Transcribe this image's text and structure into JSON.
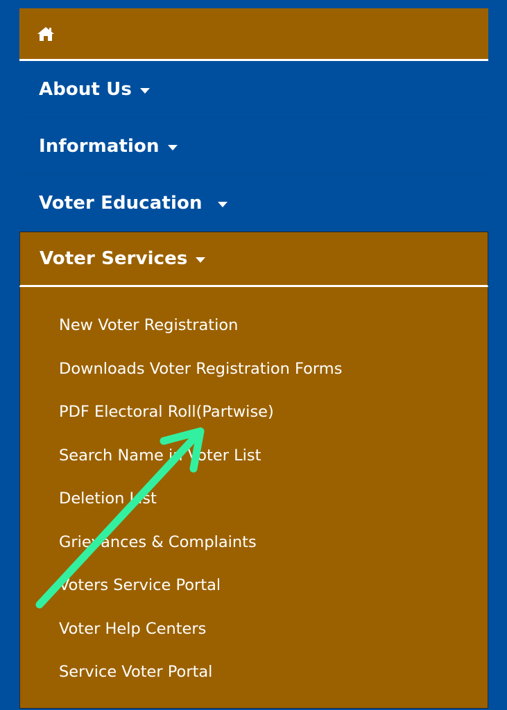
{
  "nav": {
    "home_icon": "home-icon",
    "items": [
      {
        "label": "About Us"
      },
      {
        "label": "Information"
      },
      {
        "label": "Voter Education"
      },
      {
        "label": "Voter Services"
      }
    ]
  },
  "submenu": {
    "items": [
      {
        "label": "New Voter Registration"
      },
      {
        "label": "Downloads Voter Registration Forms"
      },
      {
        "label": "PDF Electoral Roll(Partwise)"
      },
      {
        "label": "Search Name in Voter List"
      },
      {
        "label": "Deletion List"
      },
      {
        "label": "Grievances & Complaints"
      },
      {
        "label": "Voters Service Portal"
      },
      {
        "label": "Voter Help Centers"
      },
      {
        "label": "Service Voter Portal"
      }
    ]
  },
  "colors": {
    "background": "#004f9e",
    "menu_brown": "#9b6100",
    "annotation_arrow": "#33f0a0"
  }
}
